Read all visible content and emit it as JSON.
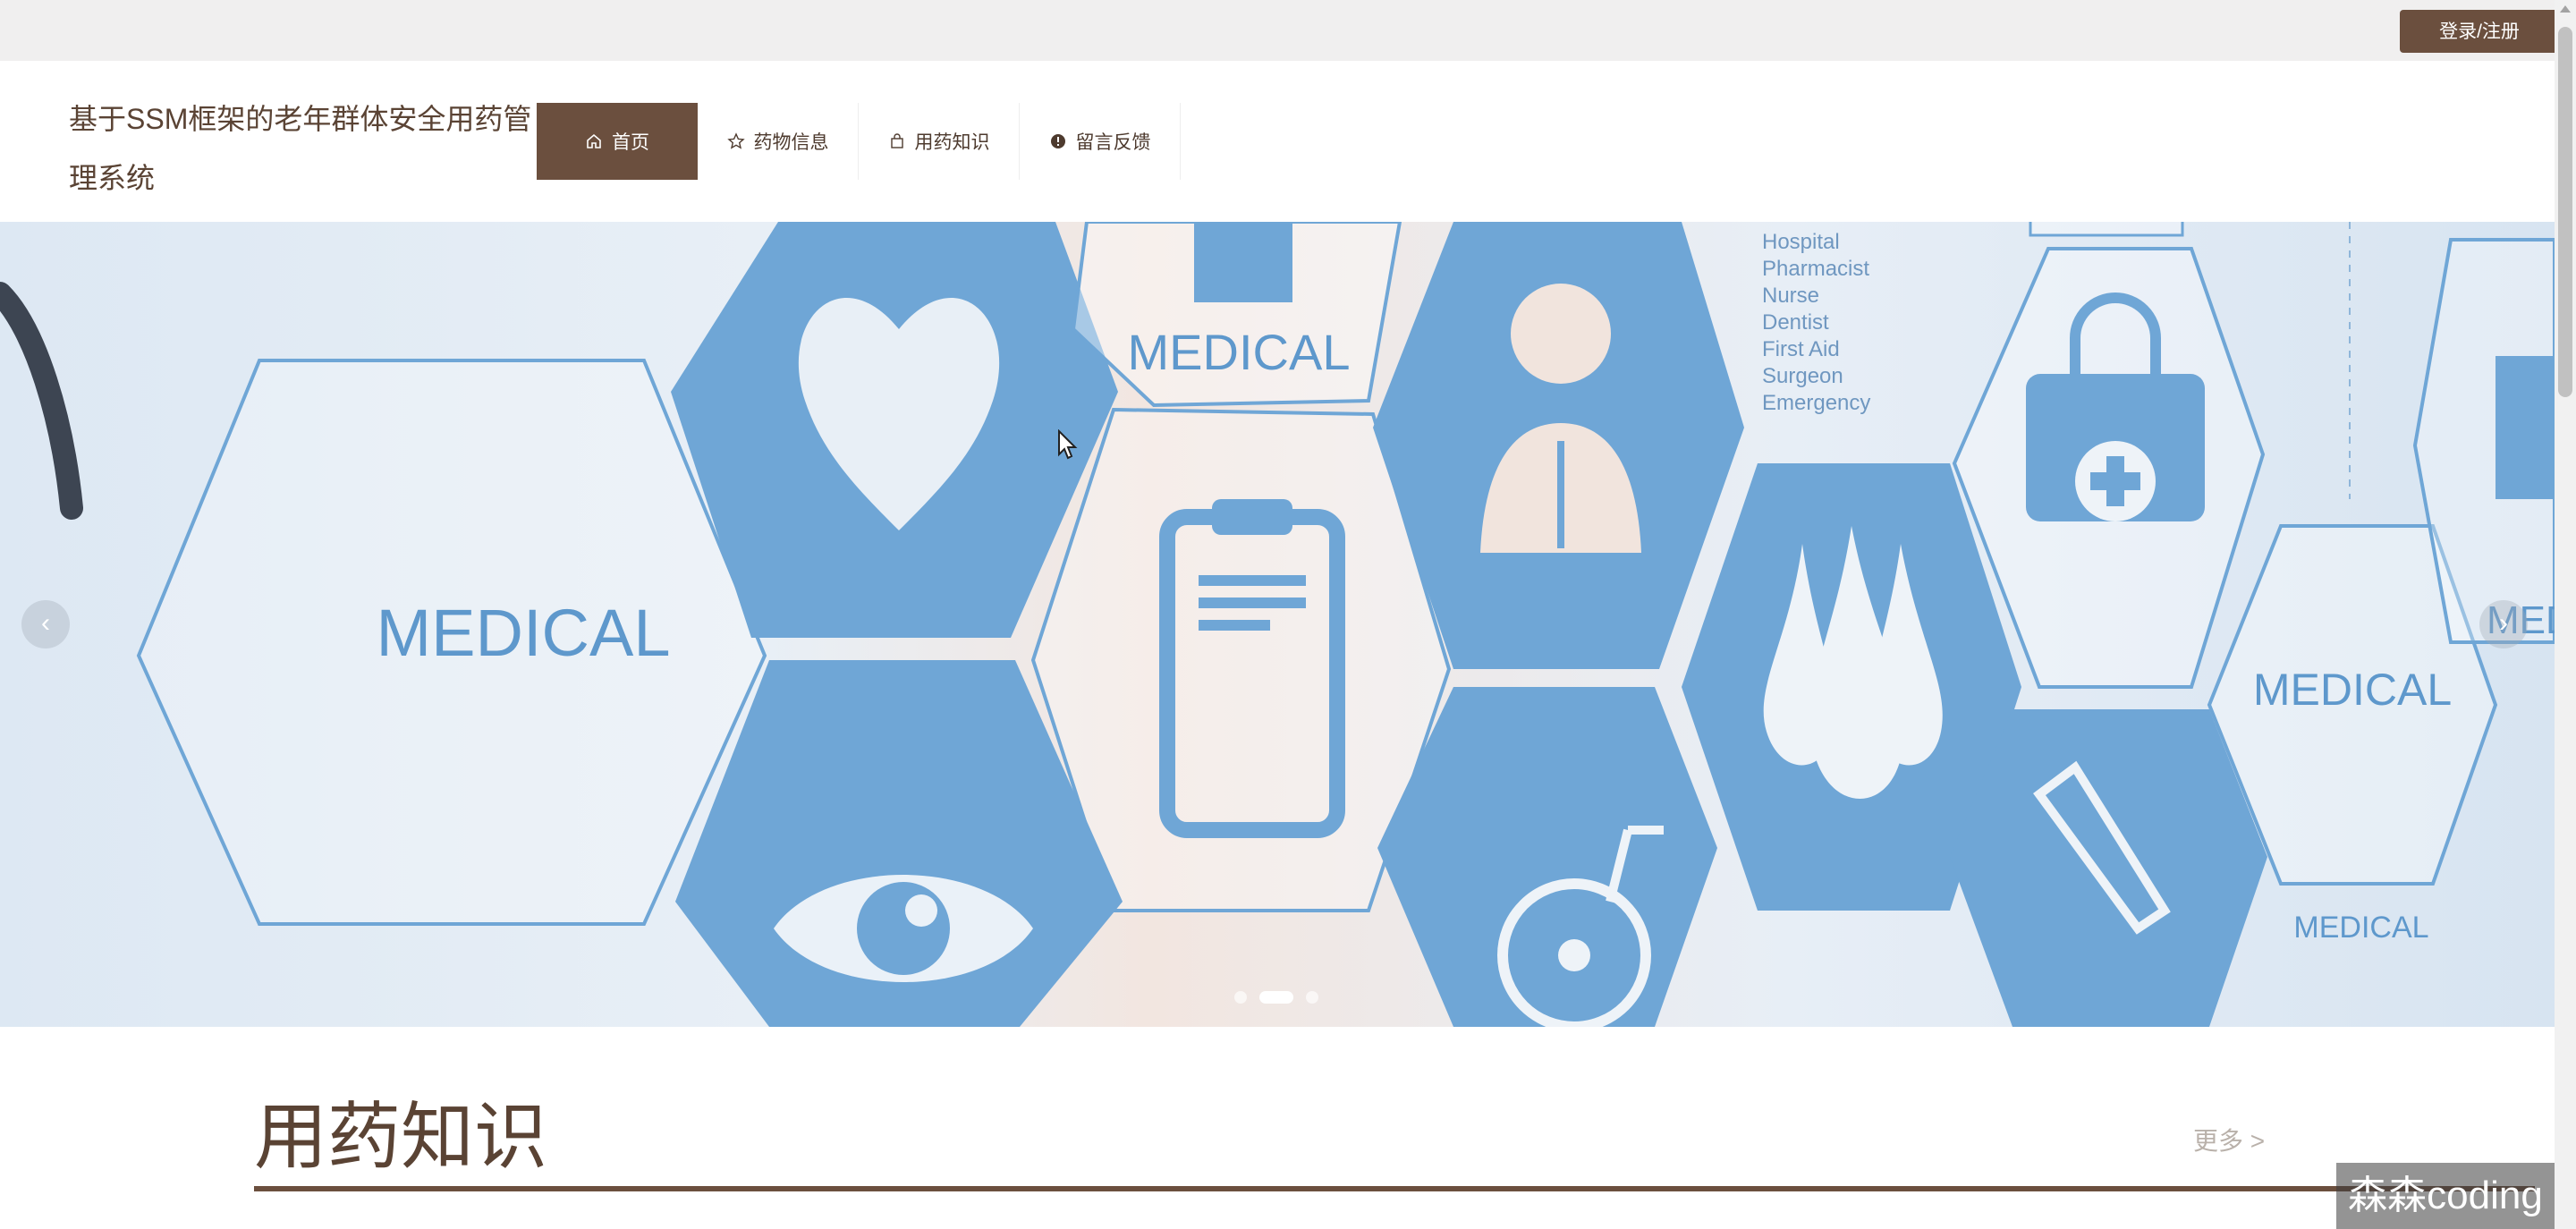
{
  "topbar": {
    "login_label": "登录/注册"
  },
  "header": {
    "site_title": "基于SSM框架的老年群体安全用药管理系统"
  },
  "nav": {
    "items": [
      {
        "label": "首页",
        "icon": "home-icon",
        "active": true
      },
      {
        "label": "药物信息",
        "icon": "star-icon",
        "active": false
      },
      {
        "label": "用药知识",
        "icon": "bag-icon",
        "active": false
      },
      {
        "label": "留言反馈",
        "icon": "info-icon",
        "active": false
      }
    ]
  },
  "banner": {
    "arrow_left": "‹",
    "arrow_right": "›",
    "image_text": {
      "medical_1": "MEDICAL",
      "medical_2": "MEDICAL",
      "medical_3": "MEDICAL",
      "medical_4": "MEDICAL",
      "medical_5": "MEDICAL",
      "list": [
        "Hospital",
        "Pharmacist",
        "Nurse",
        "Dentist",
        "First Aid",
        "Surgeon",
        "Emergency"
      ]
    },
    "slide_count": 3,
    "active_slide": 2
  },
  "section": {
    "title": "用药知识",
    "more": "更多 >"
  },
  "watermark": "森森coding",
  "colors": {
    "brand": "#6b4f3e",
    "title_text": "#5a4334",
    "hex_blue": "#6fa6d6",
    "topbar_bg": "#f0efef"
  }
}
